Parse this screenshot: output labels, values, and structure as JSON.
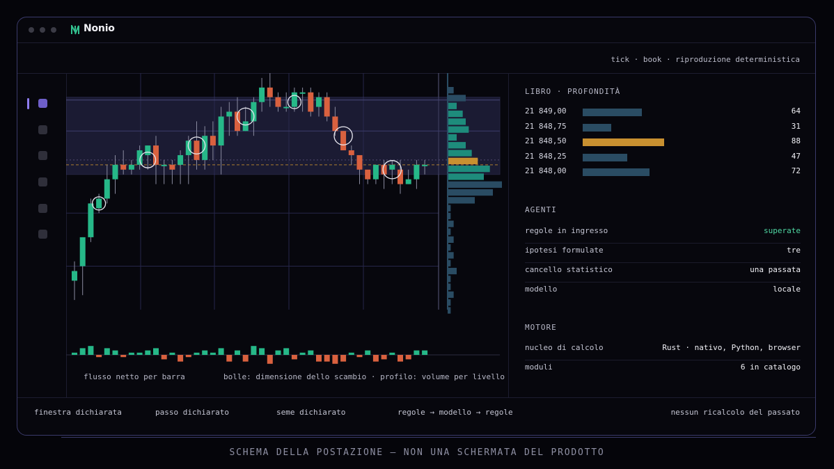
{
  "app": {
    "name": "Nonio"
  },
  "header": {
    "subtitle": "tick · book · riproduzione deterministica"
  },
  "sidebar": {
    "items": [
      "item-1",
      "item-2",
      "item-3",
      "item-4",
      "item-5",
      "item-6"
    ]
  },
  "chart": {
    "flow_caption": "flusso netto per barra",
    "legend_caption": "bolle: dimensione dello scambio · profilo: volume per livello"
  },
  "book": {
    "title": "LIBRO · PROFONDITÀ",
    "rows": [
      {
        "price": "21 849,00",
        "qty": "64",
        "level": 0.73,
        "highlight": false
      },
      {
        "price": "21 848,75",
        "qty": "31",
        "level": 0.35,
        "highlight": false
      },
      {
        "price": "21 848,50",
        "qty": "88",
        "level": 1.0,
        "highlight": true
      },
      {
        "price": "21 848,25",
        "qty": "47",
        "level": 0.55,
        "highlight": false
      },
      {
        "price": "21 848,00",
        "qty": "72",
        "level": 0.82,
        "highlight": false
      }
    ]
  },
  "agents": {
    "title": "AGENTI",
    "rows": [
      {
        "key": "regole in ingresso",
        "value": "superate",
        "status": "ok"
      },
      {
        "key": "ipotesi formulate",
        "value": "tre"
      },
      {
        "key": "cancello statistico",
        "value": "una passata"
      },
      {
        "key": "modello",
        "value": "locale"
      }
    ]
  },
  "engine": {
    "title": "MOTORE",
    "rows": [
      {
        "key": "nucleo di calcolo",
        "value": "Rust · nativo, Python, browser"
      },
      {
        "key": "moduli",
        "value": "6 in catalogo"
      }
    ]
  },
  "footer": {
    "left": [
      "finestra dichiarata",
      "passo dichiarato",
      "seme dichiarato",
      "regole → modello → regole"
    ],
    "right": "nessun ricalcolo del passato"
  },
  "caption": "SCHEMA DELLA POSTAZIONE — NON UNA SCHERMATA DEL PRODOTTO",
  "colors": {
    "up": "#26b888",
    "down": "#d9613f",
    "accent": "#8e7cf0",
    "poc": "#c89030",
    "bar": "#2a4c63"
  },
  "chart_data": {
    "type": "candlestick",
    "y_unit": "price (unlabeled)",
    "candles": [
      {
        "o": 10,
        "h": 14,
        "l": 6,
        "c": 12
      },
      {
        "o": 13,
        "h": 19,
        "l": 7,
        "c": 19
      },
      {
        "o": 19,
        "h": 27,
        "l": 18,
        "c": 26
      },
      {
        "o": 25,
        "h": 28,
        "l": 24,
        "c": 27
      },
      {
        "o": 27,
        "h": 34,
        "l": 26,
        "c": 31
      },
      {
        "o": 31,
        "h": 36,
        "l": 28,
        "c": 34
      },
      {
        "o": 34,
        "h": 37,
        "l": 32,
        "c": 33
      },
      {
        "o": 33,
        "h": 35,
        "l": 32,
        "c": 34
      },
      {
        "o": 34,
        "h": 38,
        "l": 33,
        "c": 37
      },
      {
        "o": 36,
        "h": 38,
        "l": 33,
        "c": 38
      },
      {
        "o": 38,
        "h": 40,
        "l": 30,
        "c": 34
      },
      {
        "o": 34,
        "h": 35,
        "l": 30,
        "c": 34
      },
      {
        "o": 34,
        "h": 35,
        "l": 30,
        "c": 33
      },
      {
        "o": 34,
        "h": 37,
        "l": 30,
        "c": 36
      },
      {
        "o": 36,
        "h": 40,
        "l": 30,
        "c": 39
      },
      {
        "o": 39,
        "h": 43,
        "l": 33,
        "c": 35
      },
      {
        "o": 35,
        "h": 42,
        "l": 33,
        "c": 40
      },
      {
        "o": 40,
        "h": 43,
        "l": 35,
        "c": 38
      },
      {
        "o": 38,
        "h": 46,
        "l": 32,
        "c": 44
      },
      {
        "o": 44,
        "h": 47,
        "l": 40,
        "c": 45
      },
      {
        "o": 45,
        "h": 48,
        "l": 40,
        "c": 41
      },
      {
        "o": 41,
        "h": 46,
        "l": 41,
        "c": 43
      },
      {
        "o": 43,
        "h": 48,
        "l": 40,
        "c": 47
      },
      {
        "o": 47,
        "h": 52,
        "l": 45,
        "c": 50
      },
      {
        "o": 50,
        "h": 53,
        "l": 46,
        "c": 48
      },
      {
        "o": 48,
        "h": 49,
        "l": 45,
        "c": 46
      },
      {
        "o": 46,
        "h": 49,
        "l": 45,
        "c": 46
      },
      {
        "o": 46,
        "h": 50,
        "l": 45,
        "c": 49
      },
      {
        "o": 49,
        "h": 50,
        "l": 45,
        "c": 49
      },
      {
        "o": 49,
        "h": 50,
        "l": 44,
        "c": 45
      },
      {
        "o": 46,
        "h": 49,
        "l": 44,
        "c": 48
      },
      {
        "o": 48,
        "h": 49,
        "l": 43,
        "c": 44
      },
      {
        "o": 44,
        "h": 46,
        "l": 40,
        "c": 41
      },
      {
        "o": 41,
        "h": 41,
        "l": 37,
        "c": 37
      },
      {
        "o": 37,
        "h": 38,
        "l": 34,
        "c": 36
      },
      {
        "o": 36,
        "h": 36,
        "l": 30,
        "c": 33
      },
      {
        "o": 33,
        "h": 32,
        "l": 30,
        "c": 31
      },
      {
        "o": 31,
        "h": 34,
        "l": 30,
        "c": 34
      },
      {
        "o": 34,
        "h": 35,
        "l": 29,
        "c": 32
      },
      {
        "o": 33,
        "h": 35,
        "l": 30,
        "c": 34
      },
      {
        "o": 33,
        "h": 35,
        "l": 28,
        "c": 30
      },
      {
        "o": 30,
        "h": 33,
        "l": 30,
        "c": 31
      },
      {
        "o": 31,
        "h": 35,
        "l": 29,
        "c": 34
      },
      {
        "o": 34,
        "h": 35,
        "l": 32,
        "c": 34
      }
    ],
    "bubbles": [
      {
        "i": 3,
        "price": 26,
        "size": 1
      },
      {
        "i": 9,
        "price": 35,
        "size": 1.4
      },
      {
        "i": 15,
        "price": 38,
        "size": 1.6
      },
      {
        "i": 21,
        "price": 44,
        "size": 1.6
      },
      {
        "i": 27,
        "price": 47,
        "size": 1.0
      },
      {
        "i": 33,
        "price": 40,
        "size": 1.8
      },
      {
        "i": 39,
        "price": 33,
        "size": 1.8
      }
    ],
    "value_area": {
      "low": 32,
      "high": 48
    },
    "poc": 34,
    "net_flow": [
      1,
      3,
      4,
      -1,
      3,
      2,
      -1,
      1,
      1,
      2,
      3,
      -2,
      1,
      -3,
      -1,
      1,
      2,
      1,
      3,
      -3,
      2,
      -3,
      4,
      3,
      -4,
      2,
      3,
      -2,
      1,
      2,
      -3,
      -3,
      -4,
      -3,
      1,
      -1,
      2,
      -3,
      -2,
      1,
      -3,
      -2,
      2,
      2
    ],
    "profile": [
      2,
      6,
      3,
      5,
      6,
      7,
      3,
      6,
      8,
      10,
      14,
      12,
      18,
      15,
      9,
      1,
      1,
      2,
      1,
      2,
      1,
      2,
      1,
      3,
      1,
      1,
      2,
      1,
      1
    ]
  }
}
